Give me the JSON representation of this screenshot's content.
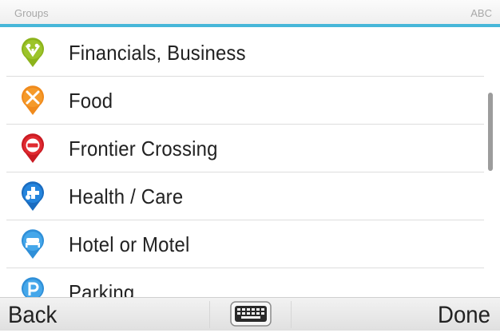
{
  "header": {
    "title": "Groups",
    "mode": "ABC"
  },
  "list": {
    "items": [
      {
        "label": "Financials, Business",
        "icon": "money-pin-icon",
        "color": "#8cb31b"
      },
      {
        "label": "Food",
        "icon": "cutlery-pin-icon",
        "color": "#f08a1c"
      },
      {
        "label": "Frontier Crossing",
        "icon": "no-entry-pin-icon",
        "color": "#d92027"
      },
      {
        "label": "Health / Care",
        "icon": "medical-cross-pin-icon",
        "color": "#1f78d1"
      },
      {
        "label": "Hotel or Motel",
        "icon": "bed-pin-icon",
        "color": "#3aa0e6"
      },
      {
        "label": "Parking",
        "icon": "parking-pin-icon",
        "color": "#3aa0e6"
      }
    ]
  },
  "footer": {
    "back_label": "Back",
    "done_label": "Done",
    "keyboard_icon": "keyboard-icon"
  }
}
